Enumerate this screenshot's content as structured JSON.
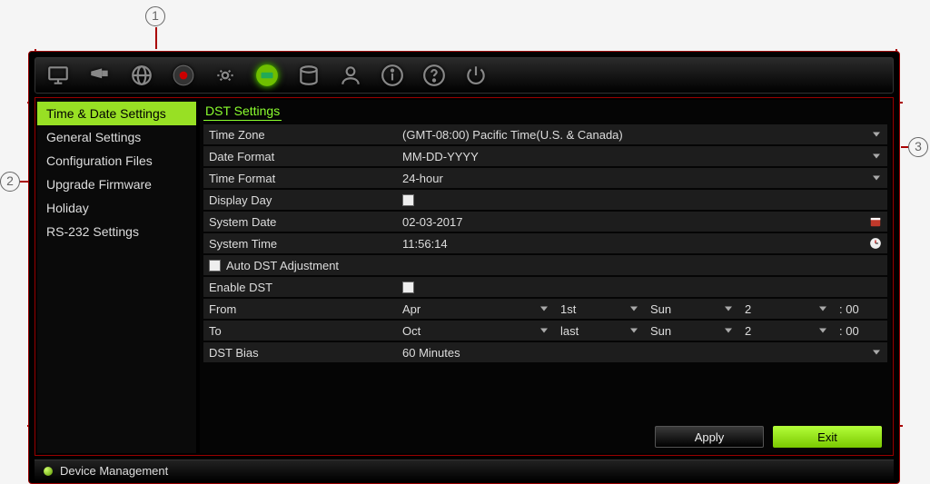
{
  "annotations": {
    "top": "1",
    "left": "2",
    "right": "3"
  },
  "sidebar": {
    "items": [
      {
        "label": "Time & Date Settings",
        "active": true
      },
      {
        "label": "General Settings"
      },
      {
        "label": "Configuration Files"
      },
      {
        "label": "Upgrade Firmware"
      },
      {
        "label": "Holiday"
      },
      {
        "label": "RS-232 Settings"
      }
    ]
  },
  "panel": {
    "title": "DST Settings",
    "timezone_label": "Time Zone",
    "timezone_value": "(GMT-08:00) Pacific Time(U.S. & Canada)",
    "dateformat_label": "Date Format",
    "dateformat_value": "MM-DD-YYYY",
    "timeformat_label": "Time Format",
    "timeformat_value": "24-hour",
    "displayday_label": "Display Day",
    "systemdate_label": "System Date",
    "systemdate_value": "02-03-2017",
    "systemtime_label": "System Time",
    "systemtime_value": "11:56:14",
    "autodst_label": "Auto DST Adjustment",
    "enabledst_label": "Enable DST",
    "from_label": "From",
    "from_month": "Apr",
    "from_week": "1st",
    "from_day": "Sun",
    "from_hour": "2",
    "from_min": ": 00",
    "to_label": "To",
    "to_month": "Oct",
    "to_week": "last",
    "to_day": "Sun",
    "to_hour": "2",
    "to_min": ": 00",
    "dstbias_label": "DST Bias",
    "dstbias_value": "60 Minutes"
  },
  "buttons": {
    "apply": "Apply",
    "exit": "Exit"
  },
  "footer": {
    "title": "Device Management"
  }
}
